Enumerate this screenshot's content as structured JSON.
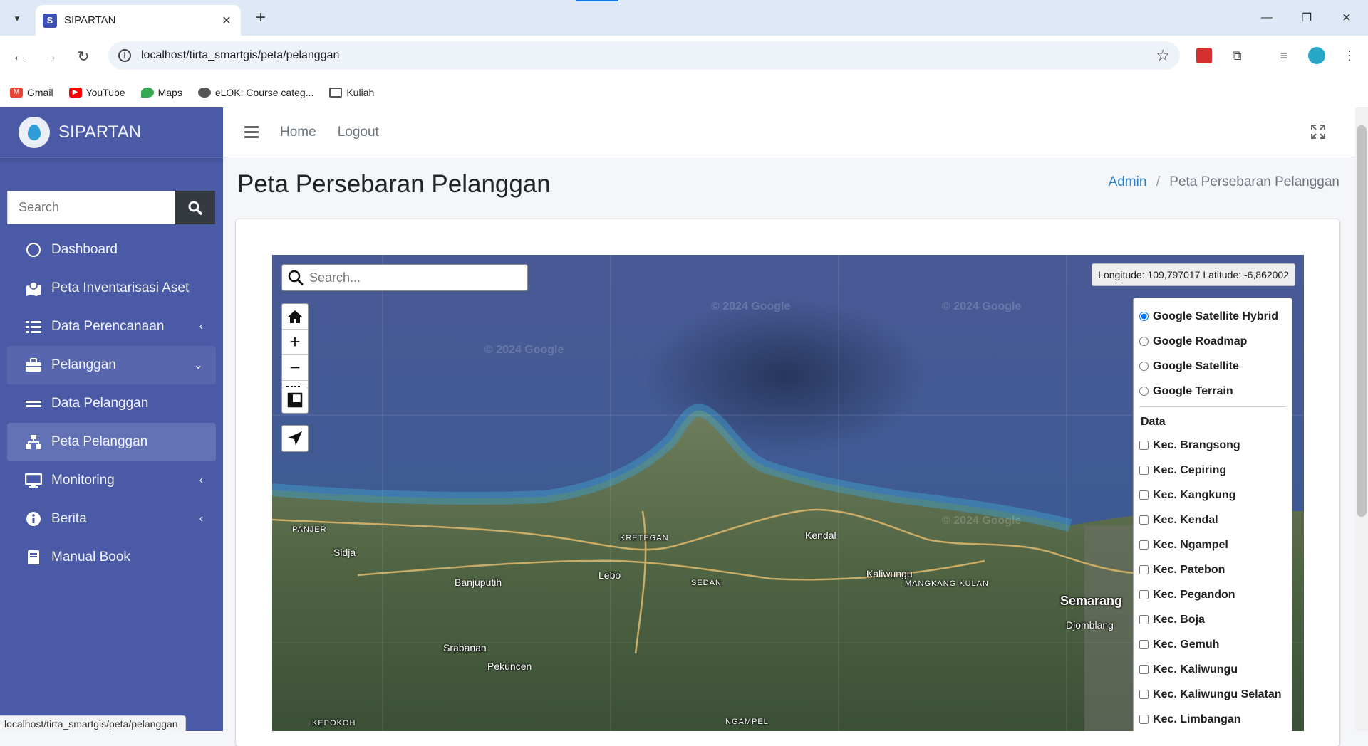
{
  "browser": {
    "tab_title": "SIPARTAN",
    "tab_favicon": "S",
    "url": "localhost/tirta_smartgis/peta/pelanggan",
    "bookmarks": [
      {
        "label": "Gmail",
        "icon": "gmail-icon"
      },
      {
        "label": "YouTube",
        "icon": "youtube-icon"
      },
      {
        "label": "Maps",
        "icon": "maps-icon"
      },
      {
        "label": "eLOK: Course categ...",
        "icon": "globe-icon"
      },
      {
        "label": "Kuliah",
        "icon": "folder-icon"
      }
    ],
    "status_url": "localhost/tirta_smartgis/peta/pelanggan"
  },
  "sidebar": {
    "brand": "SIPARTAN",
    "search_placeholder": "Search",
    "items": [
      {
        "label": "Dashboard",
        "icon": "circle-icon",
        "arrow": ""
      },
      {
        "label": "Peta Inventarisasi Aset",
        "icon": "map-marked-icon",
        "arrow": ""
      },
      {
        "label": "Data Perencanaan",
        "icon": "tasks-icon",
        "arrow": "‹"
      },
      {
        "label": "Pelanggan",
        "icon": "toolbox-icon",
        "arrow": "⌄"
      },
      {
        "label": "Data Pelanggan",
        "icon": "equals-icon",
        "arrow": ""
      },
      {
        "label": "Peta Pelanggan",
        "icon": "sitemap-icon",
        "arrow": ""
      },
      {
        "label": "Monitoring",
        "icon": "desktop-icon",
        "arrow": "‹"
      },
      {
        "label": "Berita",
        "icon": "info-circle-icon",
        "arrow": "‹"
      },
      {
        "label": "Manual Book",
        "icon": "book-icon",
        "arrow": ""
      }
    ]
  },
  "topnav": {
    "home": "Home",
    "logout": "Logout"
  },
  "page": {
    "title": "Peta Persebaran Pelanggan",
    "breadcrumb_root": "Admin",
    "breadcrumb_sep": "/",
    "breadcrumb_current": "Peta Persebaran Pelanggan"
  },
  "map": {
    "search_placeholder": "Search...",
    "coords": "Longitude: 109,797017 Latitude: -6,862002",
    "watermark": "© 2024 Google",
    "basemaps": [
      {
        "label": "Google Satellite Hybrid",
        "checked": true
      },
      {
        "label": "Google Roadmap",
        "checked": false
      },
      {
        "label": "Google Satellite",
        "checked": false
      },
      {
        "label": "Google Terrain",
        "checked": false
      }
    ],
    "data_heading": "Data",
    "data_layers": [
      "Kec. Brangsong",
      "Kec. Cepiring",
      "Kec. Kangkung",
      "Kec. Kendal",
      "Kec. Ngampel",
      "Kec. Patebon",
      "Kec. Pegandon",
      "Kec. Boja",
      "Kec. Gemuh",
      "Kec. Kaliwungu",
      "Kec. Kaliwungu Selatan",
      "Kec. Limbangan"
    ],
    "places": {
      "panjer": "PANJER",
      "sidja": "Sidja",
      "banjuputih": "Banjuputih",
      "kretegan": "KRETEGAN",
      "lebo": "Lebo",
      "sedan": "SEDAN",
      "kendal": "Kendal",
      "kaliwungu": "Kaliwungu",
      "mangkang": "MANGKANG KULAN",
      "semarang": "Semarang",
      "djomblang": "Djomblang",
      "srabanan": "Srabanan",
      "pekuncen": "Pekuncen",
      "kepokoh": "KEPOKOH",
      "ngampel": "NGAMPEL"
    }
  }
}
